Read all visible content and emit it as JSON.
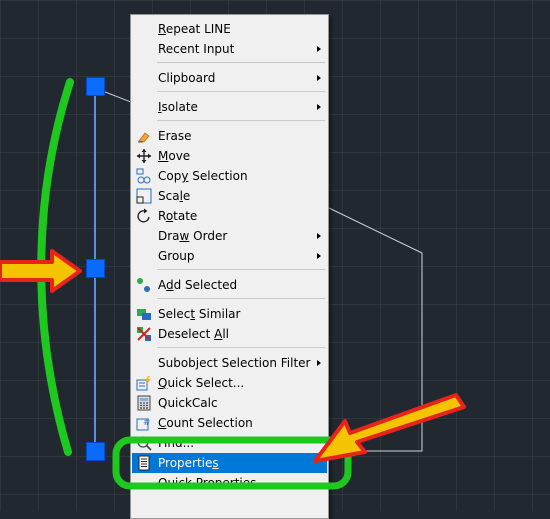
{
  "menu": {
    "items": [
      {
        "label": "Repeat LINE",
        "key": "R",
        "icon": "none",
        "submenu": false
      },
      {
        "label": "Recent Input",
        "key": "",
        "icon": "none",
        "submenu": true
      },
      {
        "label": "Clipboard",
        "key": "",
        "icon": "none",
        "submenu": true
      },
      {
        "label": "Isolate",
        "key": "I",
        "icon": "none",
        "submenu": true
      },
      {
        "label": "Erase",
        "key": "",
        "icon": "eraser-icon",
        "submenu": false
      },
      {
        "label": "Move",
        "key": "M",
        "icon": "move-icon",
        "submenu": false
      },
      {
        "label": "Copy Selection",
        "key": "y",
        "icon": "copy-icon",
        "submenu": false
      },
      {
        "label": "Scale",
        "key": "l",
        "icon": "scale-icon",
        "submenu": false
      },
      {
        "label": "Rotate",
        "key": "o",
        "icon": "rotate-icon",
        "submenu": false
      },
      {
        "label": "Draw Order",
        "key": "w",
        "icon": "none",
        "submenu": true
      },
      {
        "label": "Group",
        "key": "",
        "icon": "none",
        "submenu": true
      },
      {
        "label": "Add Selected",
        "key": "d",
        "icon": "add-selected-icon",
        "submenu": false
      },
      {
        "label": "Select Similar",
        "key": "t",
        "icon": "select-similar-icon",
        "submenu": false
      },
      {
        "label": "Deselect All",
        "key": "A",
        "icon": "deselect-icon",
        "submenu": false
      },
      {
        "label": "Subobject Selection Filter",
        "key": "",
        "icon": "none",
        "submenu": true
      },
      {
        "label": "Quick Select...",
        "key": "Q",
        "icon": "quick-select-icon",
        "submenu": false
      },
      {
        "label": "QuickCalc",
        "key": "",
        "icon": "calculator-icon",
        "submenu": false
      },
      {
        "label": "Count Selection",
        "key": "C",
        "icon": "count-icon",
        "submenu": false
      },
      {
        "label": "Find...",
        "key": "",
        "icon": "find-icon",
        "submenu": false
      },
      {
        "label": "Properties",
        "key": "s",
        "icon": "properties-icon",
        "submenu": false,
        "highlighted": true
      },
      {
        "label": "Quick Properties",
        "key": "",
        "icon": "none",
        "submenu": false
      }
    ]
  },
  "colors": {
    "canvas": "#212830",
    "grip": "#0a6cff",
    "annotation_green": "#1ec81e",
    "annotation_arrow_fill": "#f5c400",
    "annotation_arrow_outline": "#e8231a",
    "menu_highlight": "#0078d7"
  }
}
